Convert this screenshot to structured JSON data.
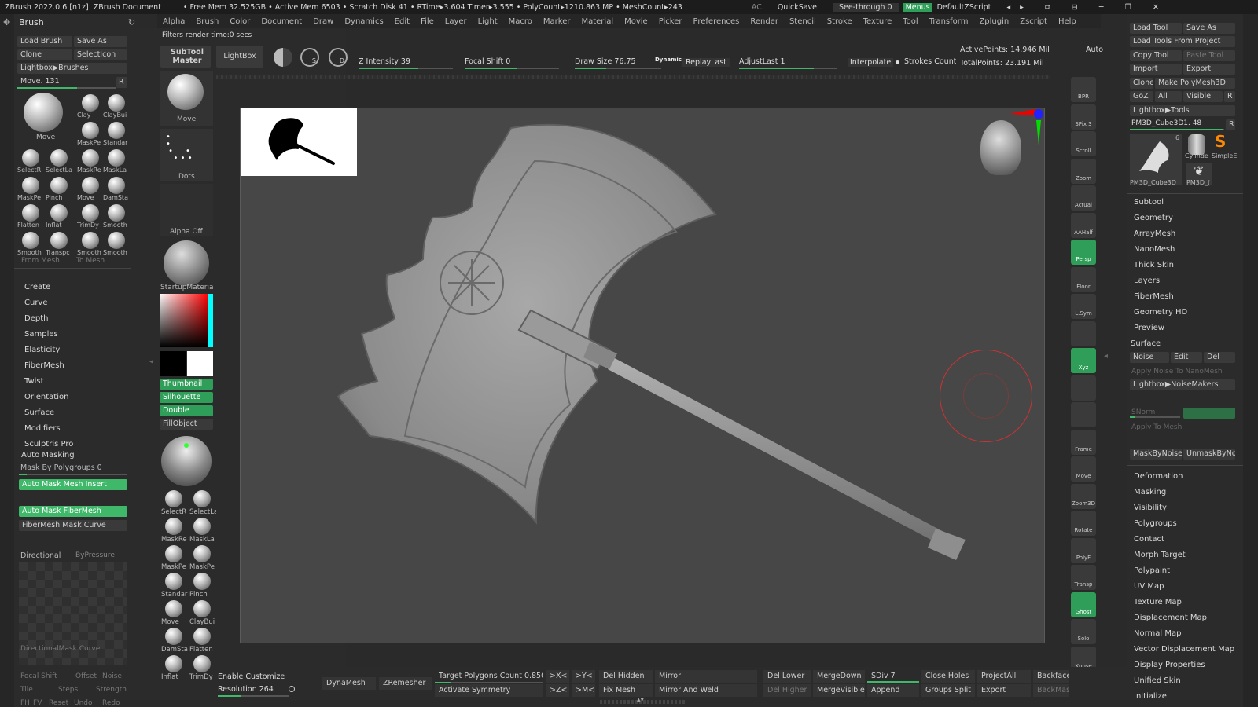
{
  "title": {
    "app": "ZBrush 2022.0.6 [n1z]",
    "doc": "ZBrush Document",
    "stats": "• Free Mem 32.525GB • Active Mem 6503 • Scratch Disk 41 • RTime▸3.604 Timer▸3.555 • PolyCount▸1210.863 MP • MeshCount▸243",
    "ac": "AC",
    "quicksave": "QuickSave",
    "seethrough": "See-through 0",
    "menus": "Menus",
    "script": "DefaultZScript"
  },
  "menu": [
    "Alpha",
    "Brush",
    "Color",
    "Document",
    "Draw",
    "Dynamics",
    "Edit",
    "File",
    "Layer",
    "Light",
    "Macro",
    "Marker",
    "Material",
    "Movie",
    "Picker",
    "Preferences",
    "Render",
    "Stencil",
    "Stroke",
    "Texture",
    "Tool",
    "Transform",
    "Zplugin",
    "Zscript",
    "Help"
  ],
  "status": "Filters render time:0 secs",
  "brush": {
    "header": "Brush",
    "load": "Load Brush",
    "saveas": "Save As",
    "clone": "Clone",
    "selecticon": "SelectIcon",
    "lightbox": "Lightbox▶Brushes",
    "move": "Move. 131",
    "r": "R",
    "big": "Move",
    "grid": [
      "Clay",
      "ClayBui",
      "MaskPe",
      "Standar",
      "SelectR",
      "SelectLa",
      "MaskRe",
      "MaskLa",
      "MaskPe",
      "Pinch",
      "Move",
      "DamSta",
      "Flatten",
      "Inflat",
      "TrimDy",
      "Smooth",
      "Smooth",
      "Transpc",
      "Smooth",
      "Smooth"
    ],
    "frommesh": "From Mesh",
    "tomesh": "To Mesh",
    "sections": [
      "Create",
      "Curve",
      "Depth",
      "Samples",
      "Elasticity",
      "FiberMesh",
      "Twist",
      "Orientation",
      "Surface",
      "Modifiers",
      "Sculptris Pro",
      "Auto Masking"
    ],
    "maskpoly": "Mask By Polygroups 0",
    "automesh": "Auto Mask Mesh Insert",
    "autofiber": "Auto Mask FiberMesh",
    "fibercurve": "FiberMesh Mask Curve",
    "directional": "Directional",
    "bypressure": "ByPressure",
    "dircurve": "DirectionalMask Curve",
    "bottom": [
      "Focal Shift",
      "Offset",
      "Noise",
      "Tile",
      "Steps",
      "Strength",
      "FH",
      "FV",
      "Reset",
      "Undo",
      "Redo"
    ]
  },
  "shelf": {
    "subtool": "SubTool Master",
    "lightbox": "LightBox",
    "move": "Move",
    "dots": "Dots",
    "alpha": "Alpha Off",
    "material": "StartupMateria",
    "thumbnail": "Thumbnail",
    "silhouette": "Silhouette",
    "double": "Double",
    "fillobject": "FillObject",
    "brushes": [
      "SelectR",
      "SelectLa",
      "MaskRe",
      "MaskLa",
      "MaskPe",
      "MaskPe",
      "Standar",
      "Pinch",
      "Move",
      "ClayBui",
      "DamSta",
      "Flatten",
      "Inflat",
      "TrimDy"
    ]
  },
  "topbar": {
    "zintensity": "Z Intensity 39",
    "focal": "Focal Shift 0",
    "drawsize": "Draw Size 76.75",
    "dynamic": "Dynamic",
    "replay": "ReplayLast",
    "adjust": "AdjustLast 1",
    "interpolate": "Interpolate",
    "strokes": "Strokes Count",
    "active": "ActivePoints: 14.946 Mil",
    "total": "TotalPoints: 23.191 Mil",
    "auto": "Auto"
  },
  "vtools": [
    "BPR",
    "SPix 3",
    "Scroll",
    "Zoom",
    "Actual",
    "AAHalf",
    "Persp",
    "Floor",
    "L.Sym",
    "",
    "Xyz",
    "",
    "",
    "Frame",
    "Move",
    "Zoom3D",
    "Rotate",
    "PolyF",
    "Transp",
    "Ghost",
    "Solo",
    "Xpose"
  ],
  "tool": {
    "load": "Load Tool",
    "saveas": "Save As",
    "loadproj": "Load Tools From Project",
    "copy": "Copy Tool",
    "paste": "Paste Tool",
    "import": "Import",
    "export": "Export",
    "clone": "Clone",
    "make": "Make PolyMesh3D",
    "goz": "GoZ",
    "all": "All",
    "visible": "Visible",
    "r": "R",
    "lightbox": "Lightbox▶Tools",
    "current": "PM3D_Cube3D1. 48",
    "thumbs": [
      "PM3D_Cube3D",
      "Cylinde",
      "SimpleE",
      "PM3D_("
    ],
    "count": "6",
    "sections1": [
      "Subtool",
      "Geometry",
      "ArrayMesh",
      "NanoMesh",
      "Thick Skin",
      "Layers",
      "FiberMesh",
      "Geometry HD",
      "Preview",
      "Surface"
    ],
    "noise": "Noise",
    "edit": "Edit",
    "del": "Del",
    "applynano": "Apply Noise To NanoMesh",
    "noisemakers": "Lightbox▶NoiseMakers",
    "snorm": "SNorm",
    "applymesh": "Apply To Mesh",
    "maskbynoise": "MaskByNoise",
    "unmask": "UnmaskByNois",
    "sections2": [
      "Deformation",
      "Masking",
      "Visibility",
      "Polygroups",
      "Contact",
      "Morph Target",
      "Polypaint",
      "UV Map",
      "Texture Map",
      "Displacement Map",
      "Normal Map",
      "Vector Displacement Map",
      "Display Properties",
      "Unified Skin",
      "Initialize"
    ]
  },
  "bottombar": {
    "enablecust": "Enable Customize",
    "resolution": "Resolution 264",
    "dynamesh": "DynaMesh",
    "zremesher": "ZRemesher",
    "target": "Target Polygons Count 0.85036",
    "xneg": ">X<",
    "yneg": ">Y<",
    "zneg": ">Z<",
    "mneg": ">M<",
    "activate": "Activate Symmetry",
    "delhidden": "Del Hidden",
    "fixmesh": "Fix Mesh",
    "mirror": "Mirror",
    "mirrorweld": "Mirror And Weld",
    "dellower": "Del Lower",
    "delhigher": "Del Higher",
    "mergedown": "MergeDown",
    "mergevisible": "MergeVisible",
    "sdiv": "SDiv 7",
    "append": "Append",
    "closeholes": "Close Holes",
    "groupssplit": "Groups Split",
    "projectall": "ProjectAll",
    "export": "Export",
    "backface": "BackfaceM",
    "backmask": "BackMask"
  },
  "colors": {
    "accent": "#3fb86a",
    "bg": "#2a2a2a",
    "canvas": "#474747"
  }
}
